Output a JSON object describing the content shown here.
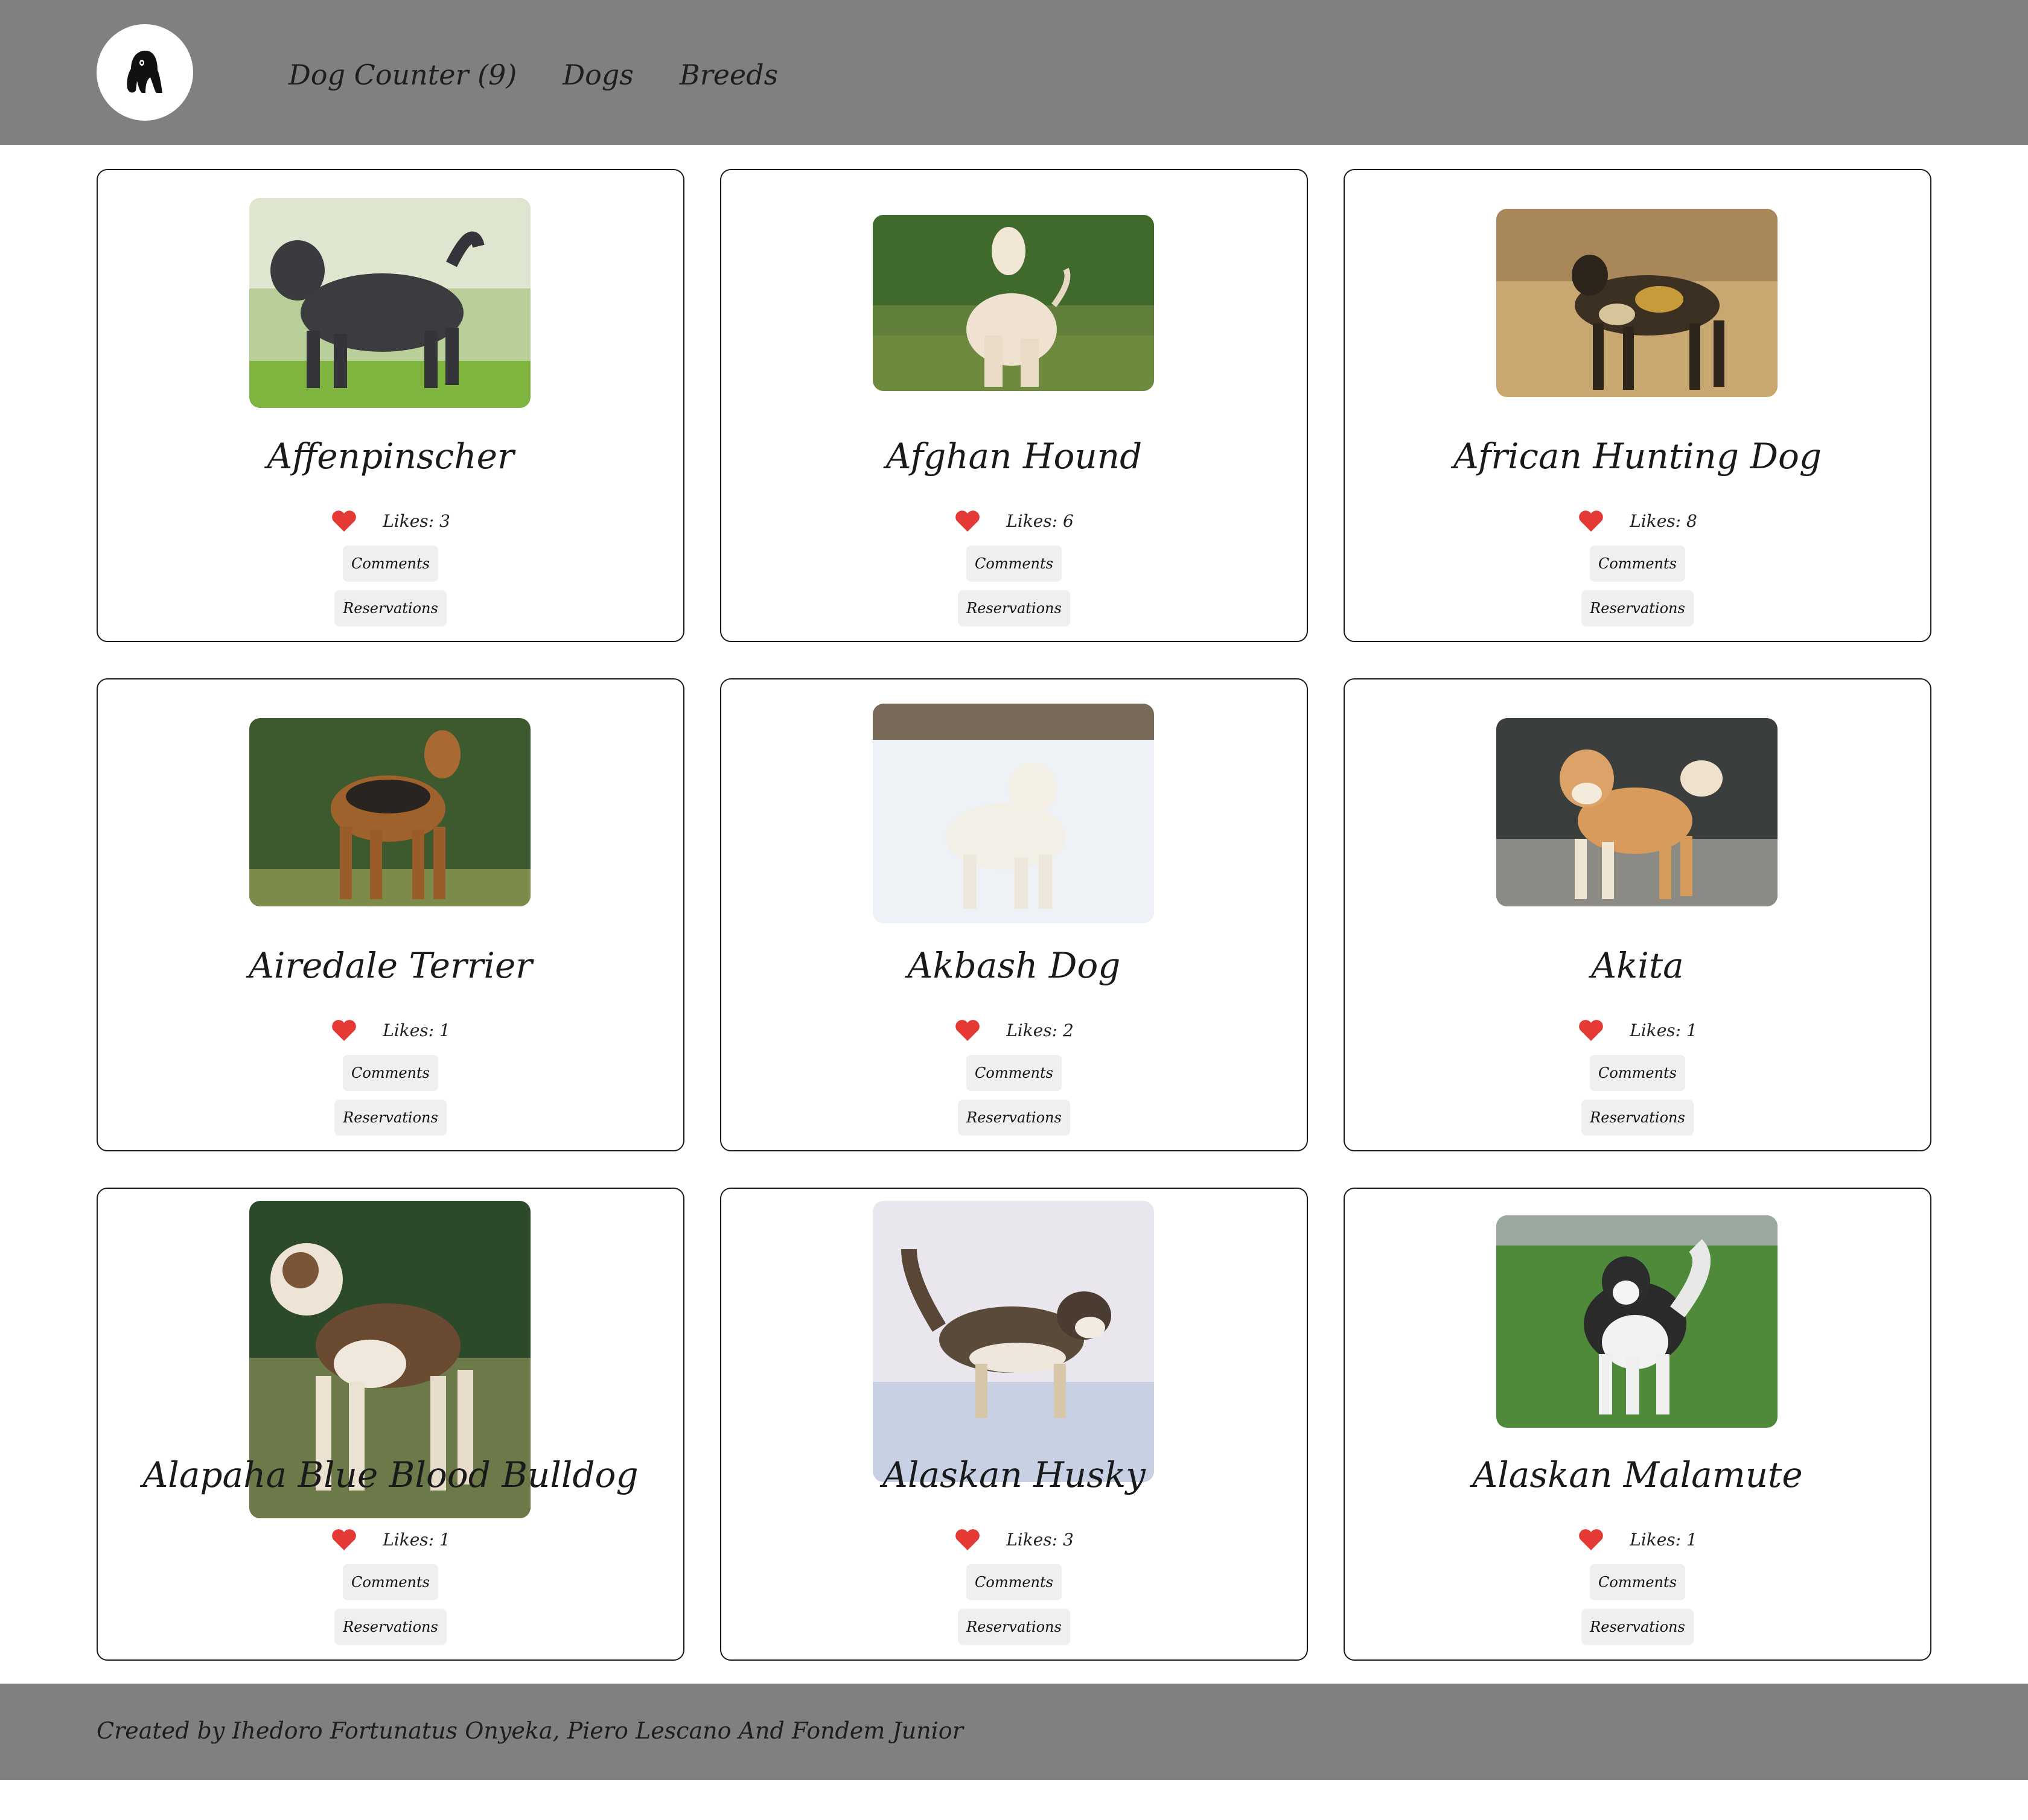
{
  "header": {
    "logo_icon": "dog-head-icon",
    "nav": [
      {
        "label": "Dog Counter (9)"
      },
      {
        "label": "Dogs"
      },
      {
        "label": "Breeds"
      }
    ]
  },
  "cards": [
    {
      "name": "Affenpinscher",
      "likes": "Likes: 3",
      "comments": "Comments",
      "reservations": "Reservations"
    },
    {
      "name": "Afghan Hound",
      "likes": "Likes: 6",
      "comments": "Comments",
      "reservations": "Reservations"
    },
    {
      "name": "African Hunting Dog",
      "likes": "Likes: 8",
      "comments": "Comments",
      "reservations": "Reservations"
    },
    {
      "name": "Airedale Terrier",
      "likes": "Likes: 1",
      "comments": "Comments",
      "reservations": "Reservations"
    },
    {
      "name": "Akbash Dog",
      "likes": "Likes: 2",
      "comments": "Comments",
      "reservations": "Reservations"
    },
    {
      "name": "Akita",
      "likes": "Likes: 1",
      "comments": "Comments",
      "reservations": "Reservations"
    },
    {
      "name": "Alapaha Blue Blood Bulldog",
      "likes": "Likes: 1",
      "comments": "Comments",
      "reservations": "Reservations"
    },
    {
      "name": "Alaskan Husky",
      "likes": "Likes: 3",
      "comments": "Comments",
      "reservations": "Reservations"
    },
    {
      "name": "Alaskan Malamute",
      "likes": "Likes: 1",
      "comments": "Comments",
      "reservations": "Reservations"
    }
  ],
  "footer": {
    "credit": "Created by Ihedoro Fortunatus Onyeka, Piero Lescano And Fondem Junior"
  },
  "colors": {
    "header_bg": "#808080",
    "heart": "#e53935",
    "button_bg": "#efefef"
  }
}
